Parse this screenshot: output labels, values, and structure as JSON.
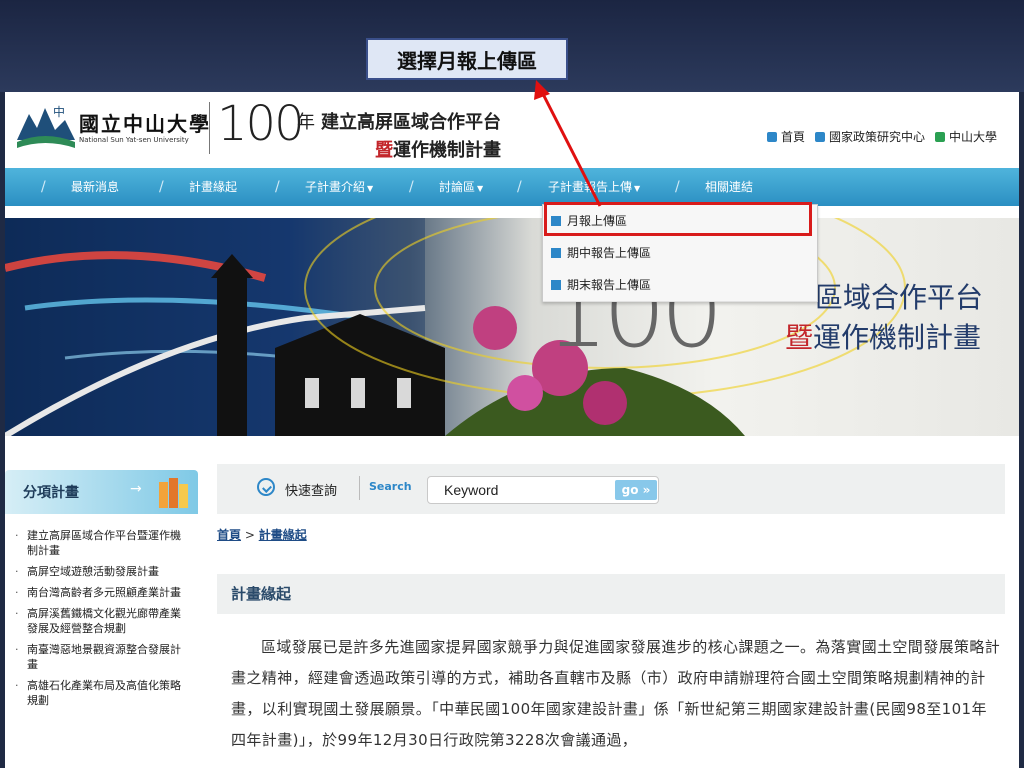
{
  "callout": {
    "label": "選擇月報上傳區"
  },
  "header": {
    "univ_zh": "國立中山大學",
    "univ_en": "National Sun Yat-sen University",
    "num": "100",
    "nian": "年",
    "title_line1": "建立高屏區域合作平台",
    "title_line2_first": "暨",
    "title_line2_rest": "運作機制計畫",
    "toplinks": [
      {
        "label": "首頁",
        "icon": "square-icon"
      },
      {
        "label": "國家政策研究中心",
        "icon": "square-icon"
      },
      {
        "label": "中山大學",
        "icon": "home-icon"
      }
    ]
  },
  "nav": {
    "items": [
      {
        "label": "最新消息"
      },
      {
        "label": "計畫緣起"
      },
      {
        "label": "子計畫介紹"
      },
      {
        "label": "討論區"
      },
      {
        "label": "子計畫報告上傳"
      },
      {
        "label": "相關連結"
      }
    ],
    "separator": "/"
  },
  "dropdown": {
    "items": [
      {
        "label": "月報上傳區"
      },
      {
        "label": "期中報告上傳區"
      },
      {
        "label": "期末報告上傳區"
      }
    ]
  },
  "banner": {
    "num": "100",
    "title_line1": "區域合作平台",
    "title_line2_first": "暨",
    "title_line2_rest": "運作機制計畫"
  },
  "sidebar": {
    "heading": "分項計畫",
    "arrow": "→",
    "items": [
      {
        "label": "建立高屏區域合作平台暨運作機制計畫"
      },
      {
        "label": "高屏空域遊憩活動發展計畫"
      },
      {
        "label": "南台灣高齡者多元照顧產業計畫"
      },
      {
        "label": "高屏溪舊鐵橋文化觀光廊帶產業發展及經營整合規劃"
      },
      {
        "label": "南臺灣惡地景觀資源整合發展計畫"
      },
      {
        "label": "高雄石化產業布局及高值化策略規劃"
      }
    ]
  },
  "search": {
    "quick_label": "快速查詢",
    "search_label": "Search",
    "value": "Keyword",
    "go_label": "go »"
  },
  "breadcrumb": {
    "home": "首頁",
    "sep": " > ",
    "current": "計畫緣起"
  },
  "section_title": "計畫緣起",
  "content": {
    "paragraph": "區域發展已是許多先進國家提昇國家競爭力與促進國家發展進步的核心課題之一。為落實國土空間發展策略計畫之精神，經建會透過政策引導的方式，補助各直轄市及縣（市）政府申請辦理符合國土空間策略規劃精神的計畫，以利實現國土發展願景。「中華民國100年國家建設計畫」係「新世紀第三期國家建設計畫(民國98至101年四年計畫)」，於99年12月30日行政院第3228次會議通過，"
  },
  "colors": {
    "accent": "#2d87c8",
    "highlight": "#d81b1b",
    "nav": "#3aa0d0"
  }
}
